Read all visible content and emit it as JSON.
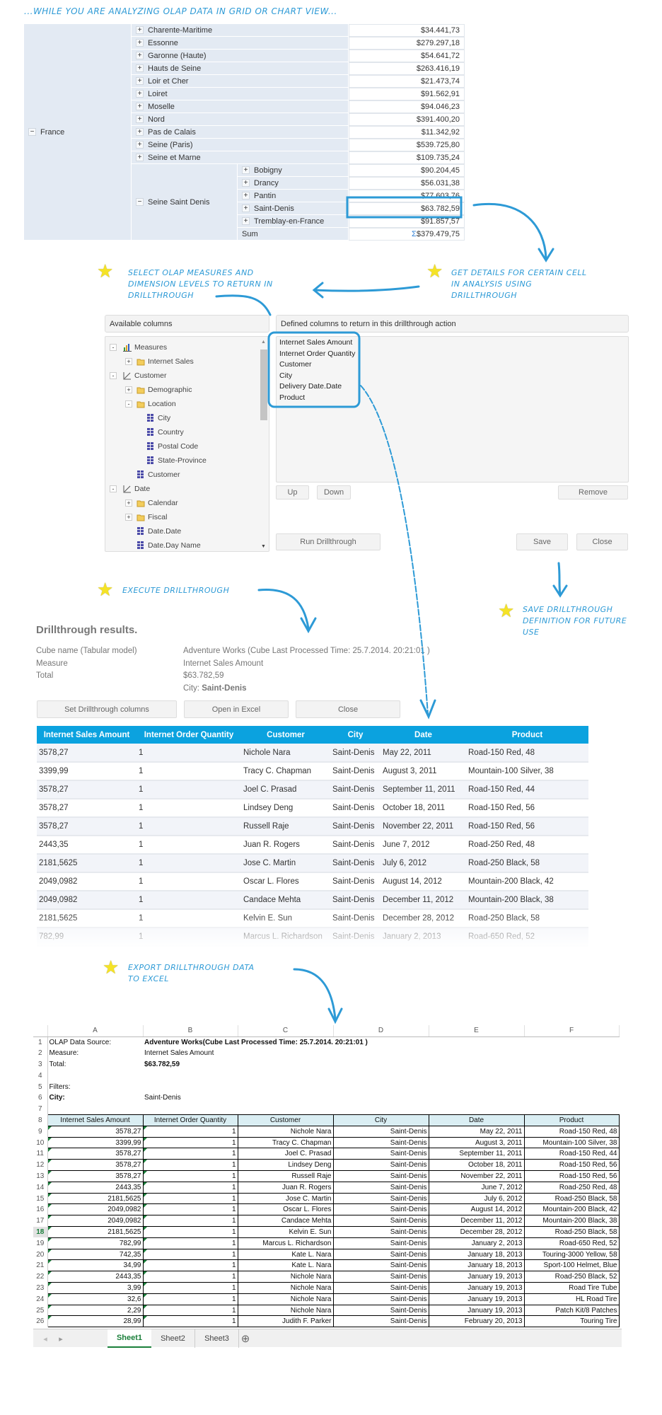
{
  "colors": {
    "accent": "#2d9ad6",
    "table_header": "#0ba2df",
    "excel_header": "#daeef3",
    "star": "#f5e326"
  },
  "notes": {
    "intro": "...while you are analyzing OLAP data in grid or chart view...",
    "select": "Select OLAP measures and dimension levels to return in drillthrough",
    "details": "Get details for certain cell in analysis using drillthrough",
    "execute": "Execute drillthrough",
    "save": "Save drillthrough definition for future use",
    "export": "Export drillthrough data to Excel"
  },
  "olap": {
    "country": "France",
    "provinces": [
      {
        "name": "Charente-Maritime",
        "value": "$34.441,73"
      },
      {
        "name": "Essonne",
        "value": "$279.297,18"
      },
      {
        "name": "Garonne (Haute)",
        "value": "$54.641,72"
      },
      {
        "name": "Hauts de Seine",
        "value": "$263.416,19"
      },
      {
        "name": "Loir et Cher",
        "value": "$21.473,74"
      },
      {
        "name": "Loiret",
        "value": "$91.562,91"
      },
      {
        "name": "Moselle",
        "value": "$94.046,23"
      },
      {
        "name": "Nord",
        "value": "$391.400,20"
      },
      {
        "name": "Pas de Calais",
        "value": "$11.342,92"
      },
      {
        "name": "Seine (Paris)",
        "value": "$539.725,80"
      },
      {
        "name": "Seine et Marne",
        "value": "$109.735,24"
      }
    ],
    "expanded": "Seine Saint Denis",
    "cities": [
      {
        "name": "Bobigny",
        "value": "$90.204,45"
      },
      {
        "name": "Drancy",
        "value": "$56.031,38"
      },
      {
        "name": "Pantin",
        "value": "$77.603,76"
      },
      {
        "name": "Saint-Denis",
        "value": "$63.782,59"
      },
      {
        "name": "Tremblay-en-France",
        "value": "$91.857,57"
      }
    ],
    "sum_label": "Sum",
    "sum_icon": "Σ",
    "sum_value": "$379.479,75"
  },
  "dialog": {
    "available_header": "Available columns",
    "defined_header": "Defined columns to return in this drillthrough action",
    "tree": [
      {
        "label": "Measures",
        "level": 0,
        "toggle": "-",
        "icon": "measures-icon"
      },
      {
        "label": "Internet Sales",
        "level": 1,
        "toggle": "+",
        "icon": "folder-icon"
      },
      {
        "label": "Customer",
        "level": 0,
        "toggle": "-",
        "icon": "dimension-icon"
      },
      {
        "label": "Demographic",
        "level": 1,
        "toggle": "+",
        "icon": "folder-icon"
      },
      {
        "label": "Location",
        "level": 1,
        "toggle": "-",
        "icon": "folder-icon"
      },
      {
        "label": "City",
        "level": 2,
        "toggle": "",
        "icon": "level-icon"
      },
      {
        "label": "Country",
        "level": 2,
        "toggle": "",
        "icon": "level-icon"
      },
      {
        "label": "Postal Code",
        "level": 2,
        "toggle": "",
        "icon": "level-icon"
      },
      {
        "label": "State-Province",
        "level": 2,
        "toggle": "",
        "icon": "level-icon"
      },
      {
        "label": "Customer",
        "level": 1,
        "toggle": "",
        "icon": "level-icon"
      },
      {
        "label": "Date",
        "level": 0,
        "toggle": "-",
        "icon": "dimension-icon"
      },
      {
        "label": "Calendar",
        "level": 1,
        "toggle": "+",
        "icon": "folder-icon"
      },
      {
        "label": "Fiscal",
        "level": 1,
        "toggle": "+",
        "icon": "folder-icon"
      },
      {
        "label": "Date.Date",
        "level": 1,
        "toggle": "",
        "icon": "level-icon"
      },
      {
        "label": "Date.Day Name",
        "level": 1,
        "toggle": "",
        "icon": "level-icon"
      }
    ],
    "defined": [
      "Internet Sales Amount",
      "Internet Order Quantity",
      "Customer",
      "City",
      "Delivery Date.Date",
      "Product"
    ],
    "up": "Up",
    "down": "Down",
    "remove": "Remove",
    "run": "Run Drillthrough",
    "save": "Save",
    "close": "Close"
  },
  "results": {
    "title": "Drillthrough results.",
    "cube_label": "Cube name (Tabular model)",
    "cube_value": "Adventure Works  (Cube Last Processed Time: 25.7.2014. 20:21:01 )",
    "measure_label": "Measure",
    "measure_value": "Internet Sales Amount",
    "total_label": "Total",
    "total_value": "$63.782,59",
    "filter_label": "City: ",
    "filter_value": "Saint-Denis",
    "set_columns": "Set Drillthrough columns",
    "open_excel": "Open in Excel",
    "close": "Close",
    "columns": [
      "Internet Sales Amount",
      "Internet Order Quantity",
      "Customer",
      "City",
      "Date",
      "Product"
    ],
    "rows": [
      [
        "3578,27",
        "1",
        "Nichole Nara",
        "Saint-Denis",
        "May 22, 2011",
        "Road-150 Red, 48"
      ],
      [
        "3399,99",
        "1",
        "Tracy C. Chapman",
        "Saint-Denis",
        "August 3, 2011",
        "Mountain-100 Silver, 38"
      ],
      [
        "3578,27",
        "1",
        "Joel C. Prasad",
        "Saint-Denis",
        "September 11, 2011",
        "Road-150 Red, 44"
      ],
      [
        "3578,27",
        "1",
        "Lindsey Deng",
        "Saint-Denis",
        "October 18, 2011",
        "Road-150 Red, 56"
      ],
      [
        "3578,27",
        "1",
        "Russell Raje",
        "Saint-Denis",
        "November 22, 2011",
        "Road-150 Red, 56"
      ],
      [
        "2443,35",
        "1",
        "Juan R. Rogers",
        "Saint-Denis",
        "June 7, 2012",
        "Road-250 Red, 48"
      ],
      [
        "2181,5625",
        "1",
        "Jose C. Martin",
        "Saint-Denis",
        "July 6, 2012",
        "Road-250 Black, 58"
      ],
      [
        "2049,0982",
        "1",
        "Oscar L. Flores",
        "Saint-Denis",
        "August 14, 2012",
        "Mountain-200 Black, 42"
      ],
      [
        "2049,0982",
        "1",
        "Candace Mehta",
        "Saint-Denis",
        "December 11, 2012",
        "Mountain-200 Black, 38"
      ],
      [
        "2181,5625",
        "1",
        "Kelvin E. Sun",
        "Saint-Denis",
        "December 28, 2012",
        "Road-250 Black, 58"
      ],
      [
        "782,99",
        "1",
        "Marcus L. Richardson",
        "Saint-Denis",
        "January 2, 2013",
        "Road-650 Red, 52"
      ]
    ]
  },
  "excel": {
    "col_letters": [
      "A",
      "B",
      "C",
      "D",
      "E",
      "F"
    ],
    "meta": [
      {
        "row": "1",
        "label": "OLAP Data Source:",
        "value": "Adventure Works(Cube Last Processed Time: 25.7.2014. 20:21:01 )",
        "bold_value": true,
        "bold_label": false
      },
      {
        "row": "2",
        "label": "Measure:",
        "value": "Internet Sales Amount",
        "bold_value": false,
        "bold_label": false
      },
      {
        "row": "3",
        "label": "Total:",
        "value": "$63.782,59",
        "bold_value": true,
        "bold_label": false
      },
      {
        "row": "4",
        "label": "",
        "value": "",
        "bold_value": false,
        "bold_label": false
      },
      {
        "row": "5",
        "label": "Filters:",
        "value": "",
        "bold_value": false,
        "bold_label": false
      },
      {
        "row": "6",
        "label": "City:",
        "value": "Saint-Denis",
        "bold_value": false,
        "bold_label": true
      },
      {
        "row": "7",
        "label": "",
        "value": "",
        "bold_value": false,
        "bold_label": false
      }
    ],
    "header_row": "8",
    "columns": [
      "Internet Sales Amount",
      "Internet Order Quantity",
      "Customer",
      "City",
      "Date",
      "Product"
    ],
    "rows": [
      {
        "n": "9",
        "c": [
          "3578,27",
          "1",
          "Nichole Nara",
          "Saint-Denis",
          "May 22, 2011",
          "Road-150 Red, 48"
        ]
      },
      {
        "n": "10",
        "c": [
          "3399,99",
          "1",
          "Tracy C. Chapman",
          "Saint-Denis",
          "August 3, 2011",
          "Mountain-100 Silver, 38"
        ]
      },
      {
        "n": "11",
        "c": [
          "3578,27",
          "1",
          "Joel C. Prasad",
          "Saint-Denis",
          "September 11, 2011",
          "Road-150 Red, 44"
        ]
      },
      {
        "n": "12",
        "c": [
          "3578,27",
          "1",
          "Lindsey Deng",
          "Saint-Denis",
          "October 18, 2011",
          "Road-150 Red, 56"
        ]
      },
      {
        "n": "13",
        "c": [
          "3578,27",
          "1",
          "Russell Raje",
          "Saint-Denis",
          "November 22, 2011",
          "Road-150 Red, 56"
        ]
      },
      {
        "n": "14",
        "c": [
          "2443,35",
          "1",
          "Juan R. Rogers",
          "Saint-Denis",
          "June 7, 2012",
          "Road-250 Red, 48"
        ]
      },
      {
        "n": "15",
        "c": [
          "2181,5625",
          "1",
          "Jose C. Martin",
          "Saint-Denis",
          "July 6, 2012",
          "Road-250 Black, 58"
        ]
      },
      {
        "n": "16",
        "c": [
          "2049,0982",
          "1",
          "Oscar L. Flores",
          "Saint-Denis",
          "August 14, 2012",
          "Mountain-200 Black, 42"
        ]
      },
      {
        "n": "17",
        "c": [
          "2049,0982",
          "1",
          "Candace Mehta",
          "Saint-Denis",
          "December 11, 2012",
          "Mountain-200 Black, 38"
        ]
      },
      {
        "n": "18",
        "c": [
          "2181,5625",
          "1",
          "Kelvin E. Sun",
          "Saint-Denis",
          "December 28, 2012",
          "Road-250 Black, 58"
        ]
      },
      {
        "n": "19",
        "c": [
          "782,99",
          "1",
          "Marcus L. Richardson",
          "Saint-Denis",
          "January 2, 2013",
          "Road-650 Red, 52"
        ]
      },
      {
        "n": "20",
        "c": [
          "742,35",
          "1",
          "Kate L. Nara",
          "Saint-Denis",
          "January 18, 2013",
          "Touring-3000 Yellow, 58"
        ]
      },
      {
        "n": "21",
        "c": [
          "34,99",
          "1",
          "Kate L. Nara",
          "Saint-Denis",
          "January 18, 2013",
          "Sport-100 Helmet, Blue"
        ]
      },
      {
        "n": "22",
        "c": [
          "2443,35",
          "1",
          "Nichole Nara",
          "Saint-Denis",
          "January 19, 2013",
          "Road-250 Black, 52"
        ]
      },
      {
        "n": "23",
        "c": [
          "3,99",
          "1",
          "Nichole Nara",
          "Saint-Denis",
          "January 19, 2013",
          "Road Tire Tube"
        ]
      },
      {
        "n": "24",
        "c": [
          "32,6",
          "1",
          "Nichole Nara",
          "Saint-Denis",
          "January 19, 2013",
          "HL Road Tire"
        ]
      },
      {
        "n": "25",
        "c": [
          "2,29",
          "1",
          "Nichole Nara",
          "Saint-Denis",
          "January 19, 2013",
          "Patch Kit/8 Patches"
        ]
      },
      {
        "n": "26",
        "c": [
          "28,99",
          "1",
          "Judith F. Parker",
          "Saint-Denis",
          "February 20, 2013",
          "Touring Tire"
        ]
      }
    ],
    "active_row": "18",
    "sheets": [
      "Sheet1",
      "Sheet2",
      "Sheet3"
    ],
    "active_sheet": "Sheet1",
    "add_sheet": "⊕",
    "nav_prev": "◂",
    "nav_next": "▸"
  }
}
